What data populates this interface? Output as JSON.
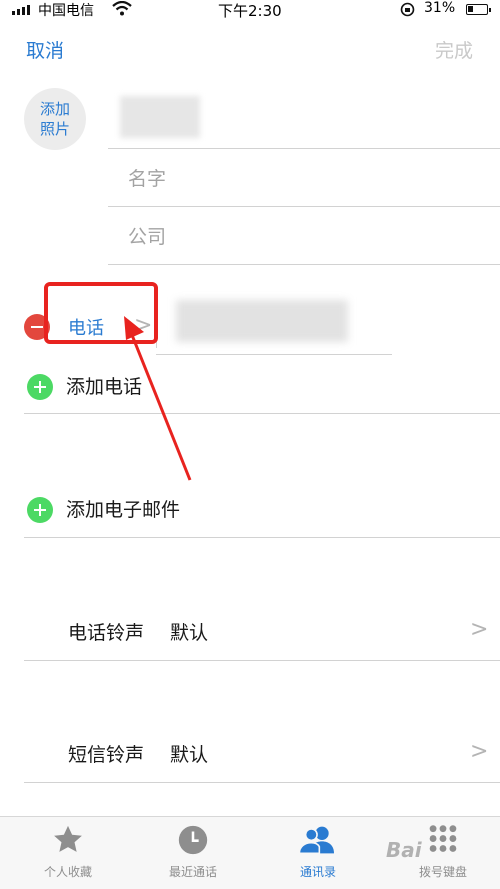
{
  "status_bar": {
    "carrier": "中国电信",
    "time": "下午2:30",
    "battery": "31%",
    "battery_level": 0.31
  },
  "nav": {
    "cancel": "取消",
    "done": "完成"
  },
  "photo": {
    "line1": "添加",
    "line2": "照片"
  },
  "fields": {
    "name_placeholder": "名字",
    "company_placeholder": "公司"
  },
  "phone": {
    "label": "电话",
    "chevron": ">"
  },
  "rows": {
    "add_phone": "添加电话",
    "add_email": "添加电子邮件",
    "ringtone_label": "电话铃声",
    "ringtone_value": "默认",
    "sms_label": "短信铃声",
    "sms_value": "默认",
    "chevron": ">"
  },
  "tabs": [
    {
      "label": "个人收藏",
      "icon": "star-icon"
    },
    {
      "label": "最近通话",
      "icon": "clock-icon"
    },
    {
      "label": "通讯录",
      "icon": "contacts-icon",
      "active": true
    },
    {
      "label": "拨号键盘",
      "icon": "keypad-icon"
    }
  ],
  "watermark": "Bai",
  "colors": {
    "accent": "#2a7bd1",
    "remove": "#e3473d",
    "add": "#4cd964",
    "annotation": "#e8231f"
  }
}
